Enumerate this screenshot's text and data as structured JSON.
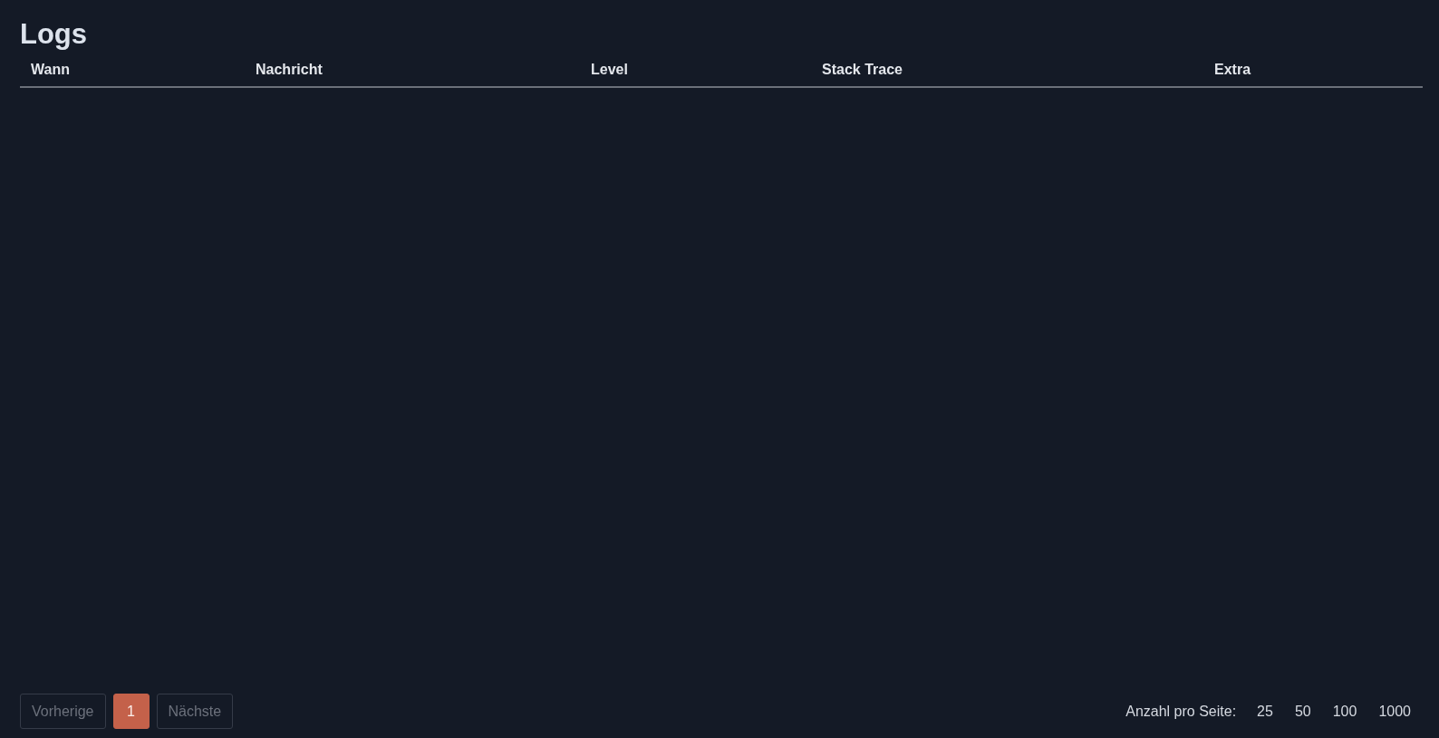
{
  "page": {
    "title": "Logs"
  },
  "table": {
    "columns": [
      "Wann",
      "Nachricht",
      "Level",
      "Stack Trace",
      "Extra"
    ]
  },
  "pagination": {
    "previous": {
      "label": "Vorherige",
      "disabled": true
    },
    "pages": [
      {
        "label": "1",
        "selected": true
      }
    ],
    "next": {
      "label": "Nächste",
      "disabled": true
    }
  },
  "page_size": {
    "label": "Anzahl pro Seite:",
    "options": [
      "25",
      "50",
      "100",
      "1000"
    ]
  }
}
